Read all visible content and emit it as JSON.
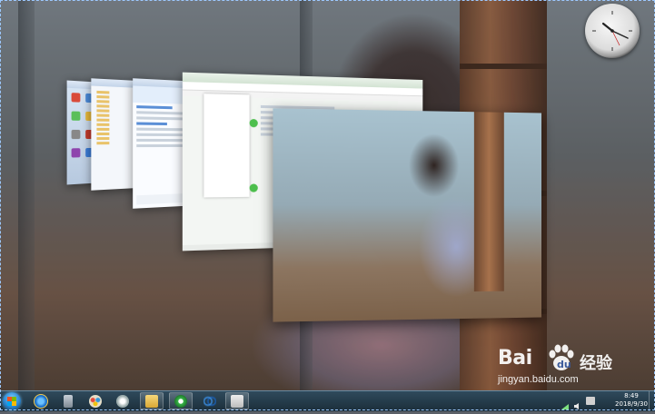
{
  "desktop": {
    "windows": [
      {
        "name": "explorer-window-1"
      },
      {
        "name": "explorer-window-2"
      },
      {
        "name": "qq-window"
      },
      {
        "name": "browser-window"
      },
      {
        "name": "photo-viewer-window"
      }
    ]
  },
  "watermark": {
    "brand": "Bai",
    "brand_suffix": "经验",
    "url": "jingyan.baidu.com"
  },
  "taskbar": {
    "items": [
      {
        "icon": "ie-icon"
      },
      {
        "icon": "calculator-icon"
      },
      {
        "icon": "paint-icon"
      },
      {
        "icon": "media-icon"
      },
      {
        "icon": "folder-icon"
      },
      {
        "icon": "refresh-icon"
      },
      {
        "icon": "qq-browser-icon"
      },
      {
        "icon": "image-viewer-icon"
      }
    ],
    "clock_time": "8:49",
    "clock_date": "2018/9/30"
  },
  "colors": {
    "taskbar": "#1b2e3a",
    "accent": "#2a86d0"
  }
}
